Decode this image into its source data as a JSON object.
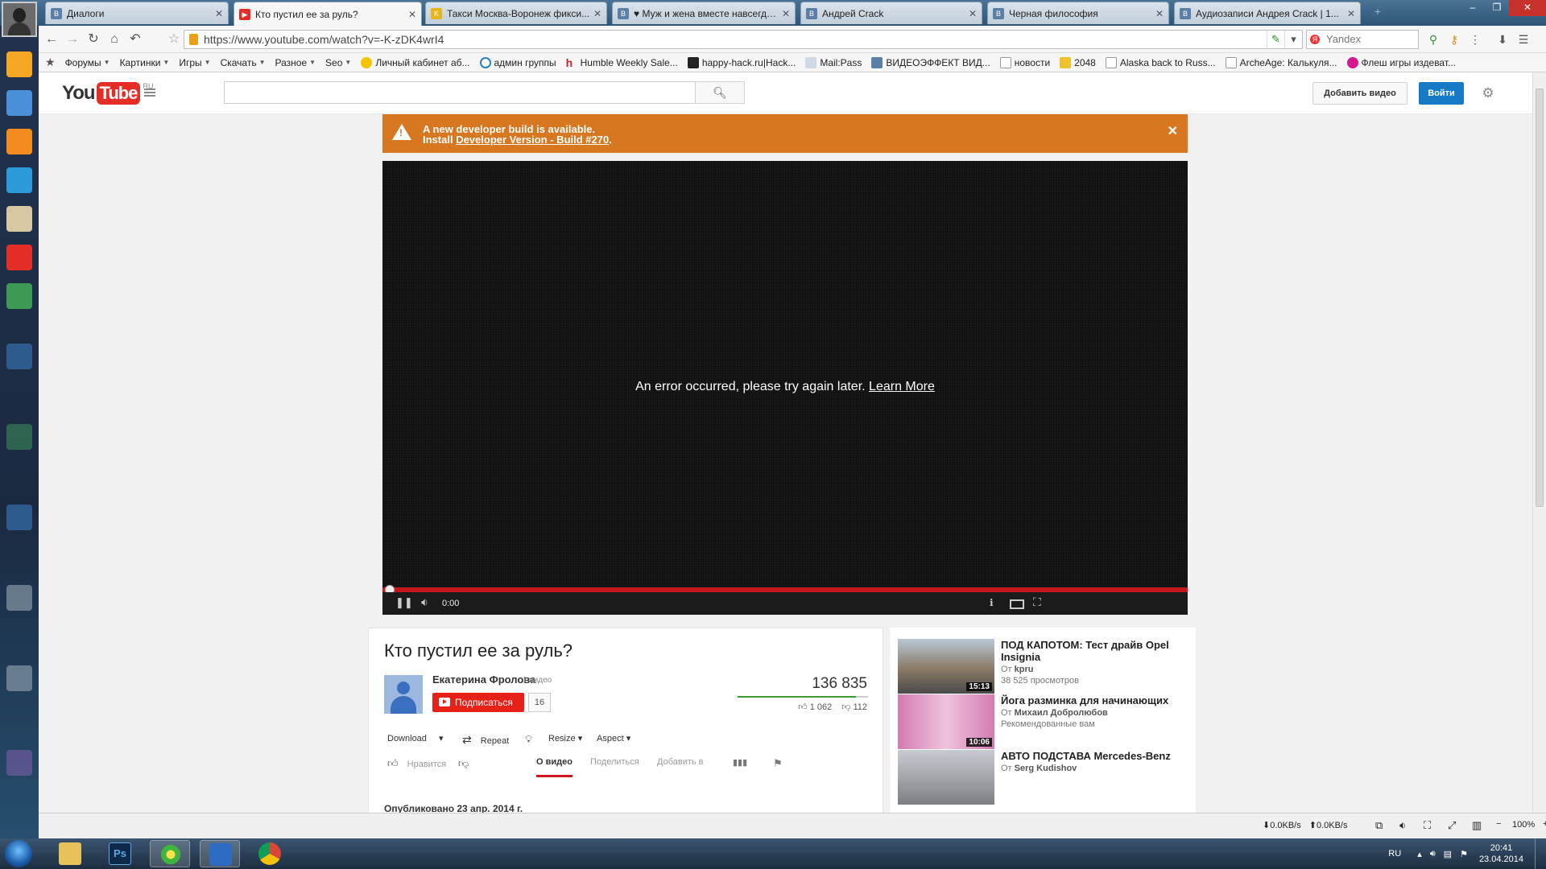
{
  "tabs": [
    {
      "title": "Диалоги",
      "icon": "vk-icon"
    },
    {
      "title": "Кто пустил ее за руль?",
      "icon": "youtube-icon",
      "active": true
    },
    {
      "title": "Такси Москва-Воронеж фикси...",
      "icon": "taxi-icon"
    },
    {
      "title": "♥ Муж и жена вместе навсегда ♥",
      "icon": "vk-icon"
    },
    {
      "title": "Андрей Crack",
      "icon": "vk-icon"
    },
    {
      "title": "Черная философия",
      "icon": "vk-icon"
    },
    {
      "title": "Аудиозаписи Андрея Crack | 1...",
      "icon": "vk-icon"
    }
  ],
  "omnibox": {
    "url": "https://www.youtube.com/watch?v=-K-zDK4wrI4"
  },
  "search_engine": {
    "placeholder": "Yandex"
  },
  "bookmarks": [
    {
      "label": "Форумы",
      "dropdown": true
    },
    {
      "label": "Картинки",
      "dropdown": true
    },
    {
      "label": "Игры",
      "dropdown": true
    },
    {
      "label": "Скачать",
      "dropdown": true
    },
    {
      "label": "Разное",
      "dropdown": true
    },
    {
      "label": "Seo",
      "dropdown": true
    },
    {
      "label": "Личный кабинет аб...",
      "icon": "beeline-icon"
    },
    {
      "label": "админ группы",
      "icon": "ok-icon"
    },
    {
      "label": "Humble Weekly Sale...",
      "icon": "humble-icon"
    },
    {
      "label": "happy-hack.ru|Hack...",
      "icon": "qr-icon"
    },
    {
      "label": "Mail:Pass",
      "icon": "mail-icon"
    },
    {
      "label": "ВИДЕОЭФФЕКТ ВИД...",
      "icon": "vk-icon"
    },
    {
      "label": "новости",
      "icon": "page-icon"
    },
    {
      "label": "2048",
      "icon": "game-icon"
    },
    {
      "label": "Alaska back to Russ...",
      "icon": "page-icon"
    },
    {
      "label": "ArcheAge: Калькуля...",
      "icon": "page-icon"
    },
    {
      "label": "Флеш игры издеват...",
      "icon": "flash-icon"
    }
  ],
  "youtube": {
    "logo_you": "You",
    "logo_tube": "Tube",
    "logo_region": "RU",
    "upload_label": "Добавить видео",
    "signin_label": "Войти"
  },
  "dev_banner": {
    "line1": "A new developer build is available.",
    "line2_prefix": "Install ",
    "line2_link": "Developer Version - Build #270",
    "line2_suffix": ".",
    "color": "#d77821"
  },
  "player": {
    "error_text": "An error occurred, please try again later.",
    "learn_more": "Learn More",
    "time": "0:00",
    "progress": 0
  },
  "video": {
    "title": "Кто пустил ее за руль?",
    "channel": "Екатерина Фролова",
    "channel_videos": "1 видео",
    "subscribe_label": "Подписаться",
    "subscriber_count": "16",
    "views": "136 835",
    "likes": "1 062",
    "dislikes": "112",
    "like_ratio": 0.905,
    "published": "Опубликовано 23 апр. 2014 г."
  },
  "actions": {
    "download": "Download",
    "repeat": "Repeat",
    "resize": "Resize",
    "aspect": "Aspect",
    "like": "Нравится"
  },
  "info_tabs": {
    "about": "О видео",
    "share": "Поделиться",
    "add_to": "Добавить в"
  },
  "related": [
    {
      "title": "ПОД КАПОТОМ: Тест драйв Opel Insignia",
      "by_prefix": "От",
      "author": "kpru",
      "meta": "38 525 просмотров",
      "duration": "15:13"
    },
    {
      "title": "Йога разминка для начинающих",
      "by_prefix": "От",
      "author": "Михаил Добролюбов",
      "meta": "Рекомендованные вам",
      "duration": "10:06"
    },
    {
      "title": "АВТО ПОДСТАВА Mercedes-Benz",
      "by_prefix": "От",
      "author": "Serg Kudishov",
      "meta": "",
      "duration": ""
    }
  ],
  "statusbar": {
    "down_speed": "0.0KB/s",
    "up_speed": "0.0KB/s",
    "zoom": "100%"
  },
  "taskbar": {
    "lang": "RU",
    "time": "20:41",
    "date": "23.04.2014"
  }
}
